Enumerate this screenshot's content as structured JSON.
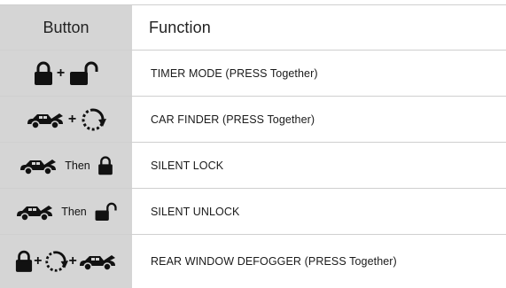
{
  "table": {
    "headers": {
      "button": "Button",
      "function": "Function"
    },
    "rows": [
      {
        "connector_1": "+",
        "connector_2": "",
        "function": "TIMER MODE   (PRESS Together)"
      },
      {
        "connector_1": "+",
        "connector_2": "",
        "function": "CAR FINDER   (PRESS Together)"
      },
      {
        "connector_1": "Then",
        "connector_2": "",
        "function": "SILENT LOCK"
      },
      {
        "connector_1": "Then",
        "connector_2": "",
        "function": "SILENT UNLOCK"
      },
      {
        "connector_1": "+",
        "connector_2": "+",
        "function": "REAR WINDOW DEFOGGER    (PRESS Together)"
      }
    ]
  },
  "icons": {
    "lock": "lock-closed-icon",
    "unlock": "lock-open-icon",
    "car": "car-trunk-open-icon",
    "finder": "car-finder-arrow-icon"
  },
  "colors": {
    "button_column_bg": "#d5d5d5",
    "row_divider": "#cfcfcf"
  }
}
